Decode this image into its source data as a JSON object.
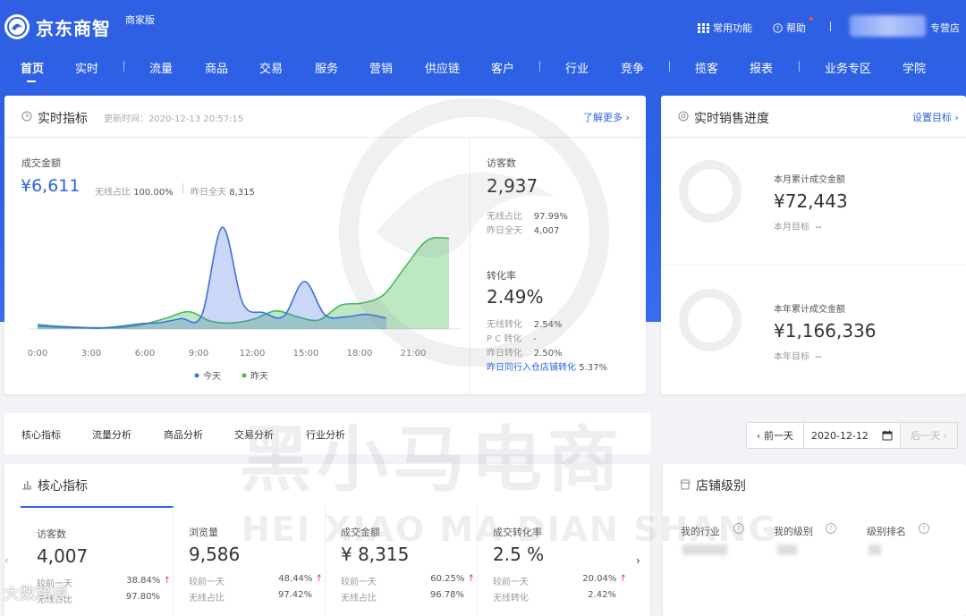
{
  "header": {
    "brand": "京东商智",
    "edition": "商家版",
    "common_functions": "常用功能",
    "help": "帮助",
    "store_type": "专营店"
  },
  "nav": [
    "首页",
    "实时",
    "流量",
    "商品",
    "交易",
    "服务",
    "营销",
    "供应链",
    "客户",
    "行业",
    "竞争",
    "揽客",
    "报表",
    "业务专区",
    "学院"
  ],
  "realtime": {
    "title": "实时指标",
    "update_label": "更新时间：",
    "update_time": "2020-12-13 20:57:15",
    "learn_more": "了解更多 ›",
    "gmv_label": "成交金额",
    "gmv_value": "¥6,611",
    "wireless_label": "无线占比",
    "wireless_value": "100.00%",
    "yesterday_label": "昨日全天",
    "yesterday_value": "8,315",
    "visitors_label": "访客数",
    "visitors_value": "2,937",
    "visitors_wireless_label": "无线占比",
    "visitors_wireless_value": "97.99%",
    "visitors_yesterday_label": "昨日全天",
    "visitors_yesterday_value": "4,007",
    "conv_label": "转化率",
    "conv_value": "2.49%",
    "conv_wireless_label": "无线转化",
    "conv_wireless_value": "2.54%",
    "conv_pc_label": "P C 转化",
    "conv_pc_value": "-",
    "conv_yesterday_label": "昨日转化",
    "conv_yesterday_value": "2.50%",
    "peer_label": "昨日同行入仓店铺转化",
    "peer_value": "5.37%"
  },
  "chart_data": {
    "type": "area",
    "x": [
      "0:00",
      "3:00",
      "6:00",
      "9:00",
      "12:00",
      "15:00",
      "18:00",
      "21:00"
    ],
    "series": [
      {
        "name": "今天",
        "color": "#3f6fe0",
        "values": [
          100,
          60,
          40,
          20,
          60,
          120,
          150,
          240,
          320,
          2350,
          600,
          380,
          300,
          1100,
          330,
          280,
          340,
          250
        ]
      },
      {
        "name": "昨天",
        "color": "#44bb55",
        "values": [
          60,
          40,
          30,
          30,
          40,
          120,
          260,
          400,
          180,
          140,
          230,
          420,
          280,
          210,
          550,
          600,
          800,
          1450,
          2050,
          2100
        ]
      }
    ],
    "legend_position": "bottom"
  },
  "sales_progress": {
    "title": "实时销售进度",
    "set_target": "设置目标 ›",
    "month_label": "本月累计成交金额",
    "month_value": "¥72,443",
    "month_target_label": "本月目标",
    "month_target_value": "--",
    "year_label": "本年累计成交金额",
    "year_value": "¥1,166,336",
    "year_target_label": "本年目标",
    "year_target_value": "--"
  },
  "tabs": [
    "核心指标",
    "流量分析",
    "商品分析",
    "交易分析",
    "行业分析"
  ],
  "date_picker": {
    "prev": "‹ 前一天",
    "date": "2020-12-12",
    "next": "后一天 ›"
  },
  "core": {
    "title": "核心指标",
    "compare_label": "较前一天",
    "wireless_label": "无线占比",
    "wireless_conv_label": "无线转化",
    "metrics": [
      {
        "name": "访客数",
        "value": "4,007",
        "change": "38.84%",
        "second": "97.80%"
      },
      {
        "name": "浏览量",
        "value": "9,586",
        "change": "48.44%",
        "second": "97.42%"
      },
      {
        "name": "成交金额",
        "value": "¥ 8,315",
        "change": "60.25%",
        "second": "96.78%"
      },
      {
        "name": "成交转化率",
        "value": "2.5 %",
        "change": "20.04%",
        "second": "2.42%"
      }
    ]
  },
  "shop_level": {
    "title": "店铺级别",
    "cols": [
      "我的行业",
      "我的级别",
      "级别排名"
    ]
  },
  "watermark": {
    "cn": "黑小马电商",
    "en": "HEI XIAO MA DIAN SHANG",
    "corner": "大数跨境"
  },
  "colors": {
    "brand_blue": "#2d63e8",
    "today": "#3f6fe0",
    "yesterday": "#44bb55",
    "up_red": "#e33"
  }
}
